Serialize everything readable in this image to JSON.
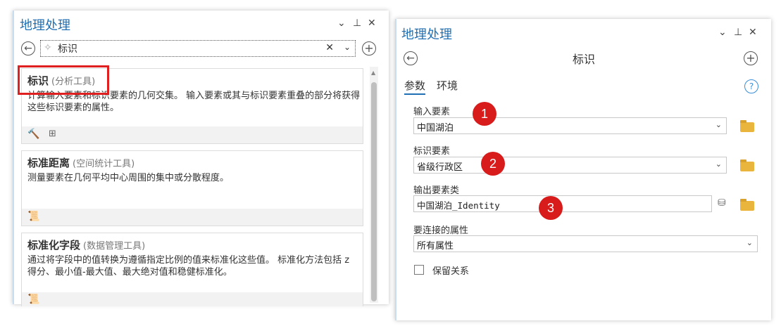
{
  "left": {
    "title": "地理处理",
    "window_controls": [
      "⌄",
      "⊥",
      "✕"
    ],
    "search": {
      "value": "标识"
    },
    "tools": [
      {
        "name": "标识",
        "toolbox": "(分析工具)",
        "description": "计算输入要素和标识要素的几何交集。 输入要素或其与标识要素重叠的部分将获得这些标识要素的属性。"
      },
      {
        "name": "标准距离",
        "toolbox": "(空间统计工具)",
        "description": "测量要素在几何平均中心周围的集中或分散程度。"
      },
      {
        "name": "标准化字段",
        "toolbox": "(数据管理工具)",
        "description": "通过将字段中的值转换为遵循指定比例的值来标准化这些值。 标准化方法包括 z 得分、最小值-最大值、最大绝对值和稳健标准化。"
      }
    ]
  },
  "right": {
    "title": "地理处理",
    "window_controls": [
      "⌄",
      "⊥",
      "✕"
    ],
    "tool_title": "标识",
    "tabs": [
      "参数",
      "环境"
    ],
    "help_icon": "?",
    "fields": [
      {
        "label": "输入要素",
        "value": "中国湖泊",
        "badge": "1"
      },
      {
        "label": "标识要素",
        "value": "省级行政区",
        "badge": "2"
      },
      {
        "label": "输出要素类",
        "value": "中国湖泊_Identity",
        "badge": "3"
      },
      {
        "label": "要连接的属性",
        "value": "所有属性"
      }
    ],
    "checkbox_label": "保留关系"
  },
  "colors": {
    "accent": "#1f6fb5",
    "highlight": "#e02020",
    "badge": "#d81b1b"
  }
}
